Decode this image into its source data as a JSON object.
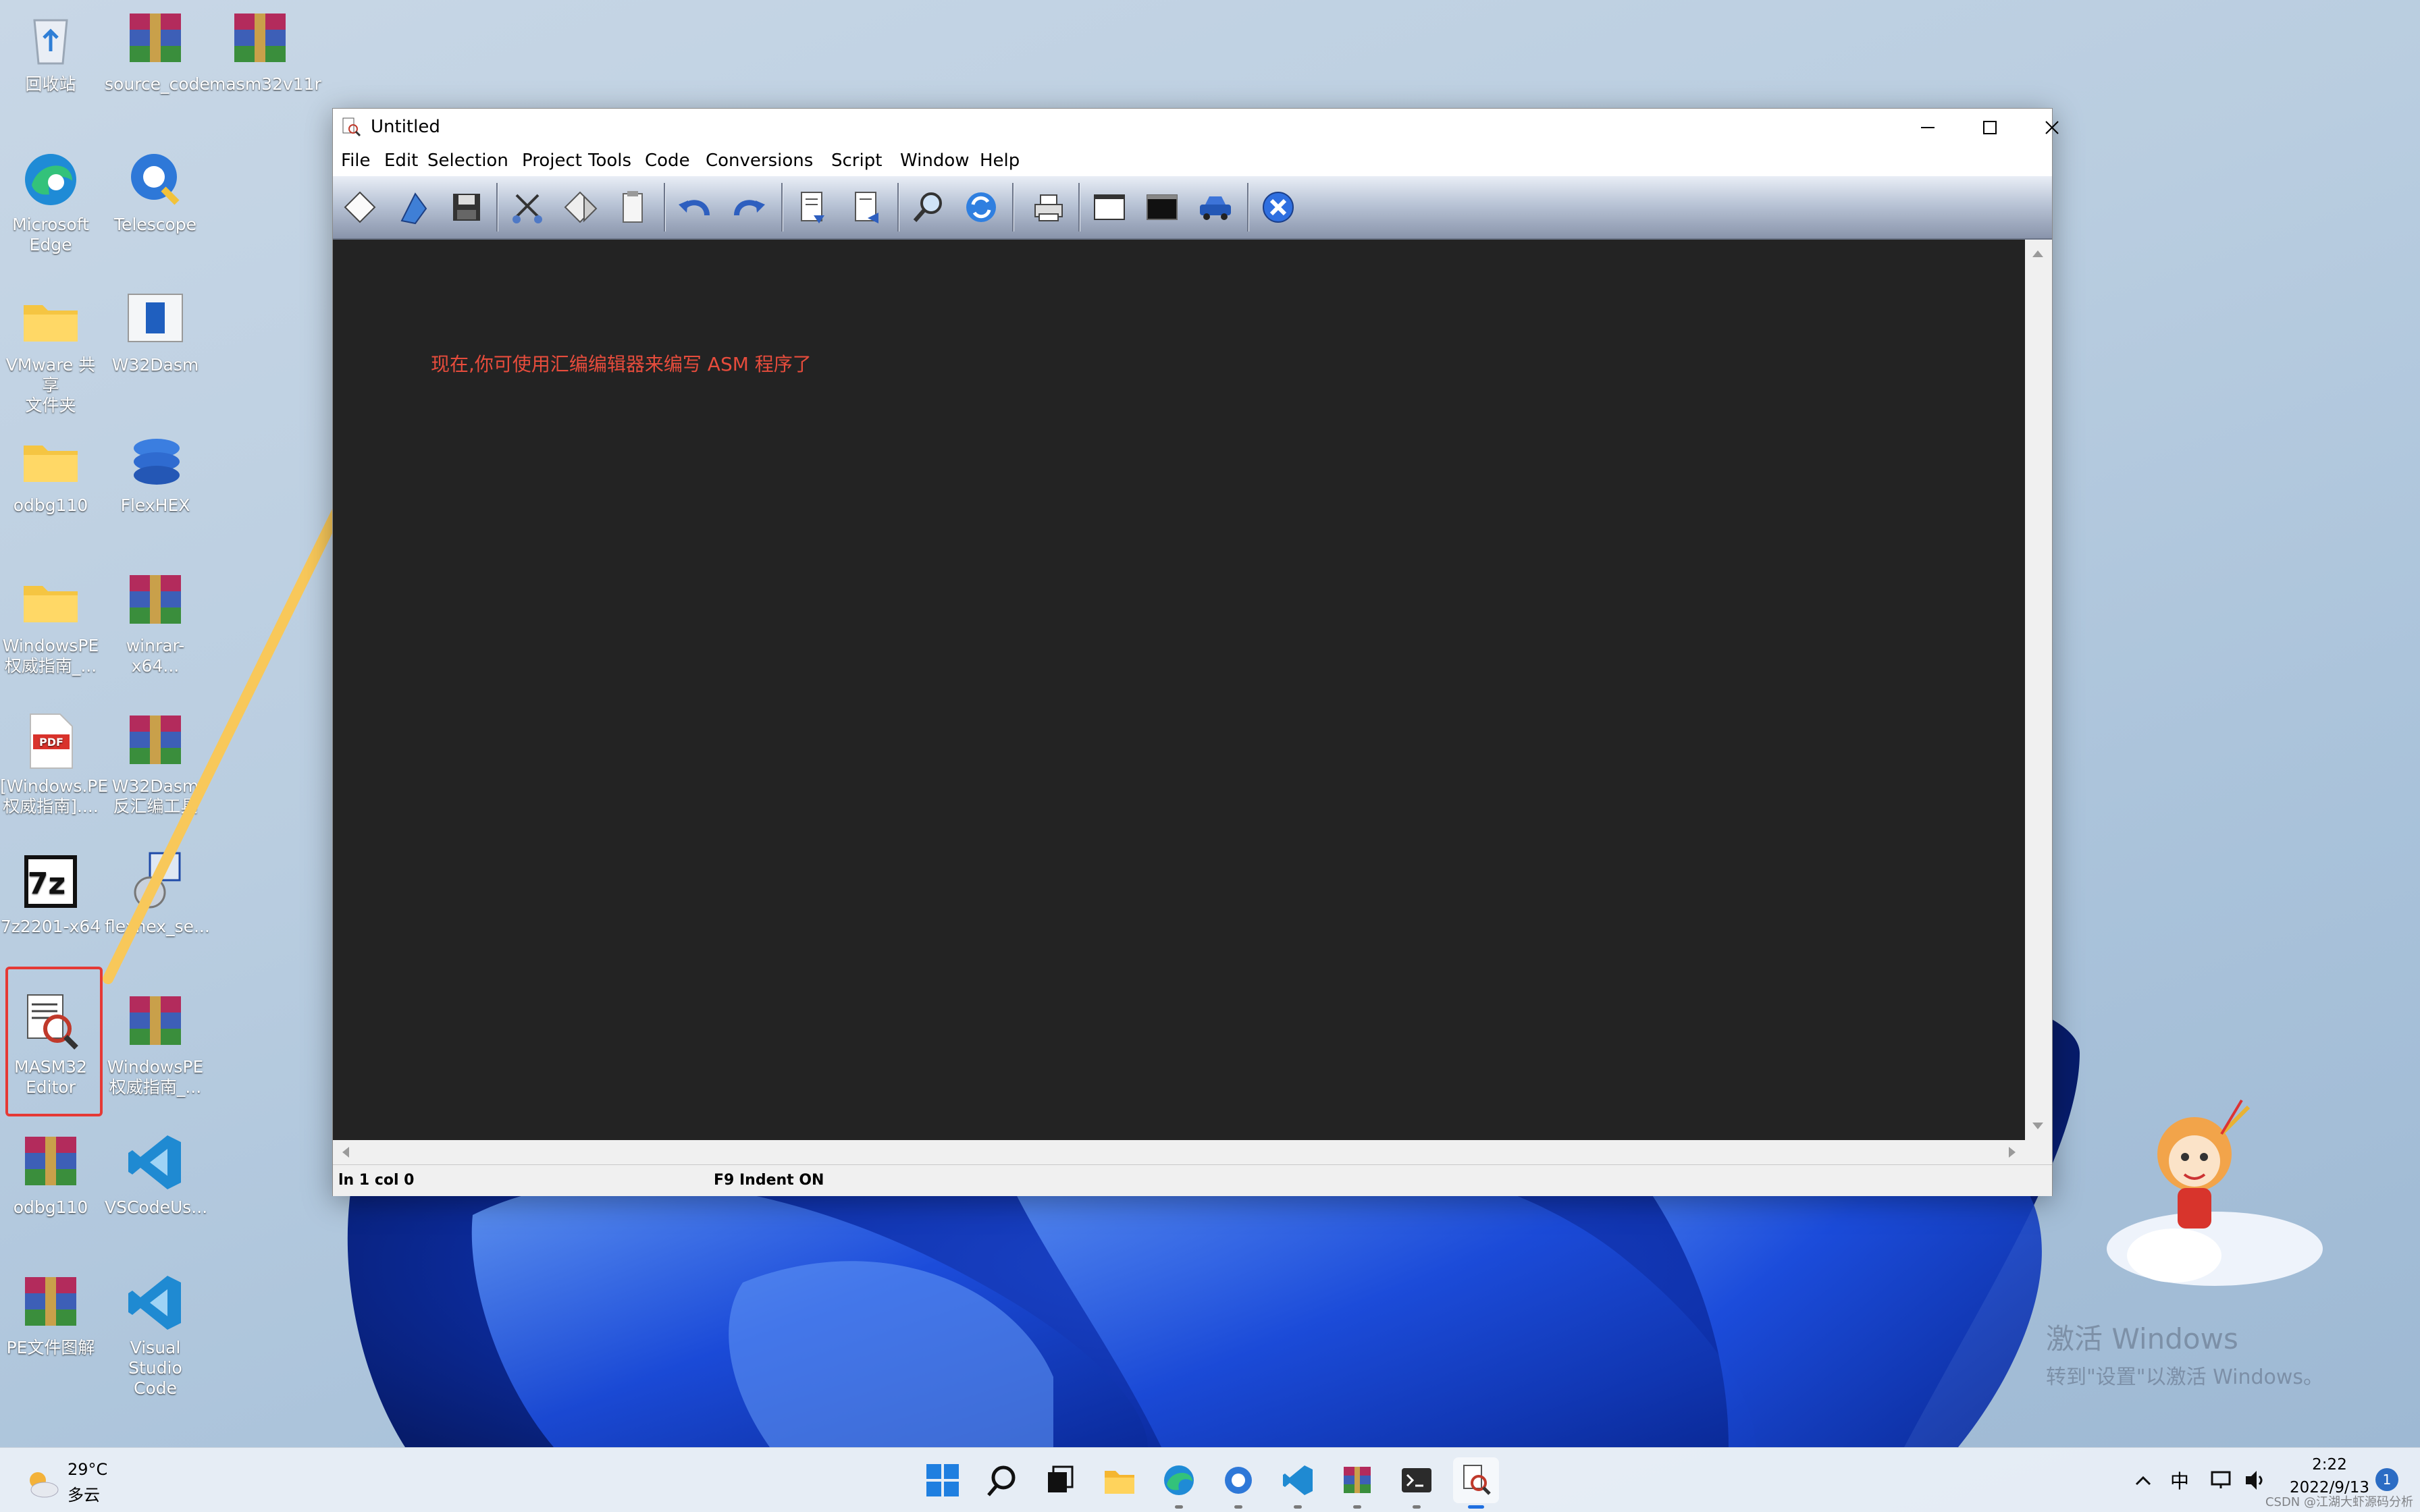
{
  "desktop": {
    "icons": [
      {
        "label": "回收站"
      },
      {
        "label": "source_code"
      },
      {
        "label": "masm32v11r"
      },
      {
        "label": "Microsoft\nEdge"
      },
      {
        "label": "Telescope"
      },
      {
        "label": "VMware 共享\n文件夹"
      },
      {
        "label": "W32Dasm"
      },
      {
        "label": "odbg110"
      },
      {
        "label": "FlexHEX"
      },
      {
        "label": "WindowsPE\n权威指南_..."
      },
      {
        "label": "winrar-x64..."
      },
      {
        "label": "[Windows.PE\n权威指南]...."
      },
      {
        "label": "W32Dasm\n反汇编工具"
      },
      {
        "label": "7z2201-x64"
      },
      {
        "label": "flexhex_se..."
      },
      {
        "label": "MASM32\nEditor"
      },
      {
        "label": "WindowsPE\n权威指南_..."
      },
      {
        "label": "odbg110"
      },
      {
        "label": "VSCodeUs..."
      },
      {
        "label": "PE文件图解"
      },
      {
        "label": "Visual Studio\nCode"
      }
    ]
  },
  "window": {
    "title": "Untitled",
    "menu": [
      "File",
      "Edit",
      "Selection",
      "Project",
      "Tools",
      "Code",
      "Conversions",
      "Script",
      "Window",
      "Help"
    ],
    "toolbar_icons": [
      "new-file-icon",
      "open-file-icon",
      "save-icon",
      "cut-icon",
      "copy-icon",
      "paste-icon",
      "undo-icon",
      "redo-icon",
      "insert-file-icon",
      "save-block-icon",
      "find-icon",
      "replace-icon",
      "print-icon",
      "window-icon",
      "console-icon",
      "build-car-icon",
      "exit-icon"
    ],
    "status": {
      "position": "ln 1 col 0",
      "indent": "F9 Indent ON"
    }
  },
  "annotation": {
    "text": "现在,你可使用汇编编辑器来编写 ASM 程序了",
    "color": "#e74c3c",
    "arrow_color": "#f8c85a"
  },
  "taskbar": {
    "weather": {
      "temp": "29°C",
      "condition": "多云"
    },
    "apps": [
      "start-icon",
      "search-icon",
      "task-view-icon",
      "file-explorer-icon",
      "edge-icon",
      "cortana-icon",
      "vscode-icon",
      "winrar-icon",
      "terminal-icon",
      "masm32-editor-icon"
    ],
    "tray": {
      "ime": "中",
      "time": "2:22",
      "date": "2022/9/13",
      "notifications": "1"
    }
  },
  "watermark": {
    "line1": "激活 Windows",
    "line2": "转到\"设置\"以激活 Windows。"
  },
  "footer": {
    "credit": "CSDN @江湖大虾源码分析"
  }
}
